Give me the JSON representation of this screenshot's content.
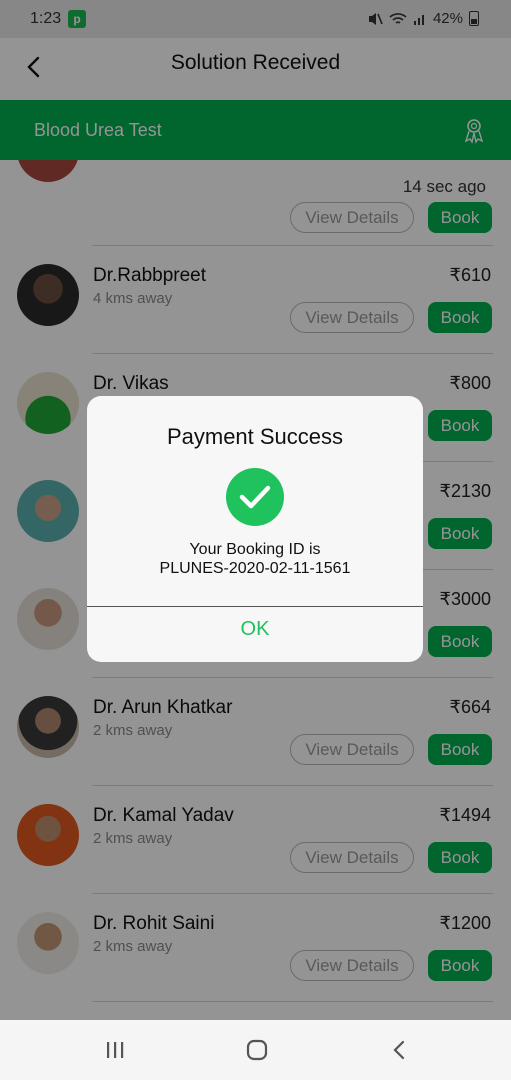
{
  "status_bar": {
    "time": "1:23",
    "app_badge": "p",
    "battery": "42%"
  },
  "header": {
    "title": "Solution Received"
  },
  "test_bar": {
    "name": "Blood Urea Test"
  },
  "list": {
    "time_ago": "14 sec ago",
    "view_label": "View Details",
    "book_label": "Book",
    "doctors": [
      {
        "name": "Dr.Rabbpreet",
        "distance": "4 kms away",
        "price": "₹610"
      },
      {
        "name": "Dr.  Vikas",
        "distance": "",
        "price": "₹800"
      },
      {
        "name": "",
        "distance": "",
        "price": "₹2130"
      },
      {
        "name": "",
        "distance": "",
        "price": "₹3000"
      },
      {
        "name": "Dr. Arun Khatkar",
        "distance": "2 kms away",
        "price": "₹664"
      },
      {
        "name": "Dr. Kamal Yadav",
        "distance": "2 kms away",
        "price": "₹1494"
      },
      {
        "name": "Dr. Rohit Saini",
        "distance": "2 kms away",
        "price": "₹1200"
      }
    ]
  },
  "dialog": {
    "title": "Payment Success",
    "booking_label": "Your Booking ID is",
    "booking_id": "PLUNES-2020-02-11-1561",
    "ok_label": "OK"
  },
  "colors": {
    "brand_green": "#00b050",
    "success_green": "#1fc25d"
  }
}
